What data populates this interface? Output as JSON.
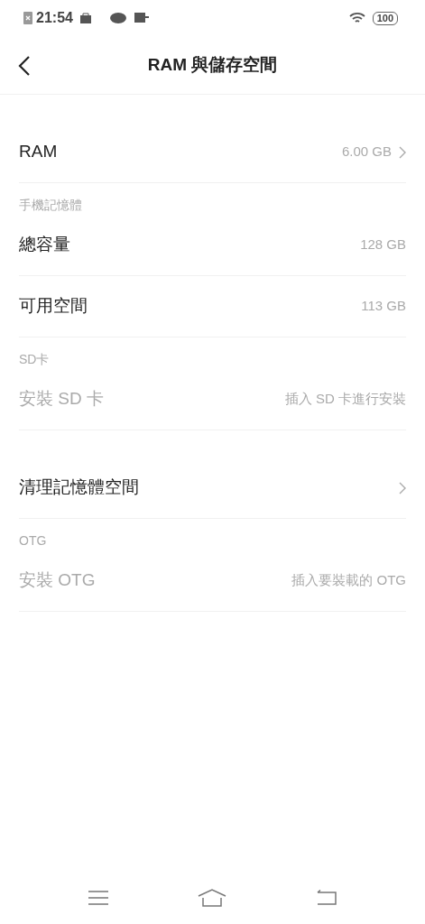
{
  "status_bar": {
    "time": "21:54",
    "battery": "100"
  },
  "header": {
    "title": "RAM 與儲存空間"
  },
  "groups": [
    {
      "items": [
        {
          "kind": "item",
          "label": "RAM",
          "value": "6.00 GB",
          "chevron": true,
          "disabled": false
        },
        {
          "kind": "header",
          "label": "手機記憶體"
        },
        {
          "kind": "item",
          "label": "總容量",
          "value": "128 GB",
          "chevron": false,
          "disabled": false
        },
        {
          "kind": "item",
          "label": "可用空間",
          "value": "113 GB",
          "chevron": false,
          "disabled": false
        },
        {
          "kind": "header",
          "label": "SD卡"
        },
        {
          "kind": "item",
          "label": "安裝 SD 卡",
          "value": "插入 SD 卡進行安裝",
          "chevron": false,
          "disabled": true
        }
      ]
    },
    {
      "items": [
        {
          "kind": "item",
          "label": "清理記憶體空間",
          "chevron": true,
          "disabled": false
        },
        {
          "kind": "header",
          "label": "OTG"
        },
        {
          "kind": "item",
          "label": "安裝 OTG",
          "value": "插入要裝載的 OTG",
          "chevron": false,
          "disabled": true
        }
      ]
    }
  ]
}
